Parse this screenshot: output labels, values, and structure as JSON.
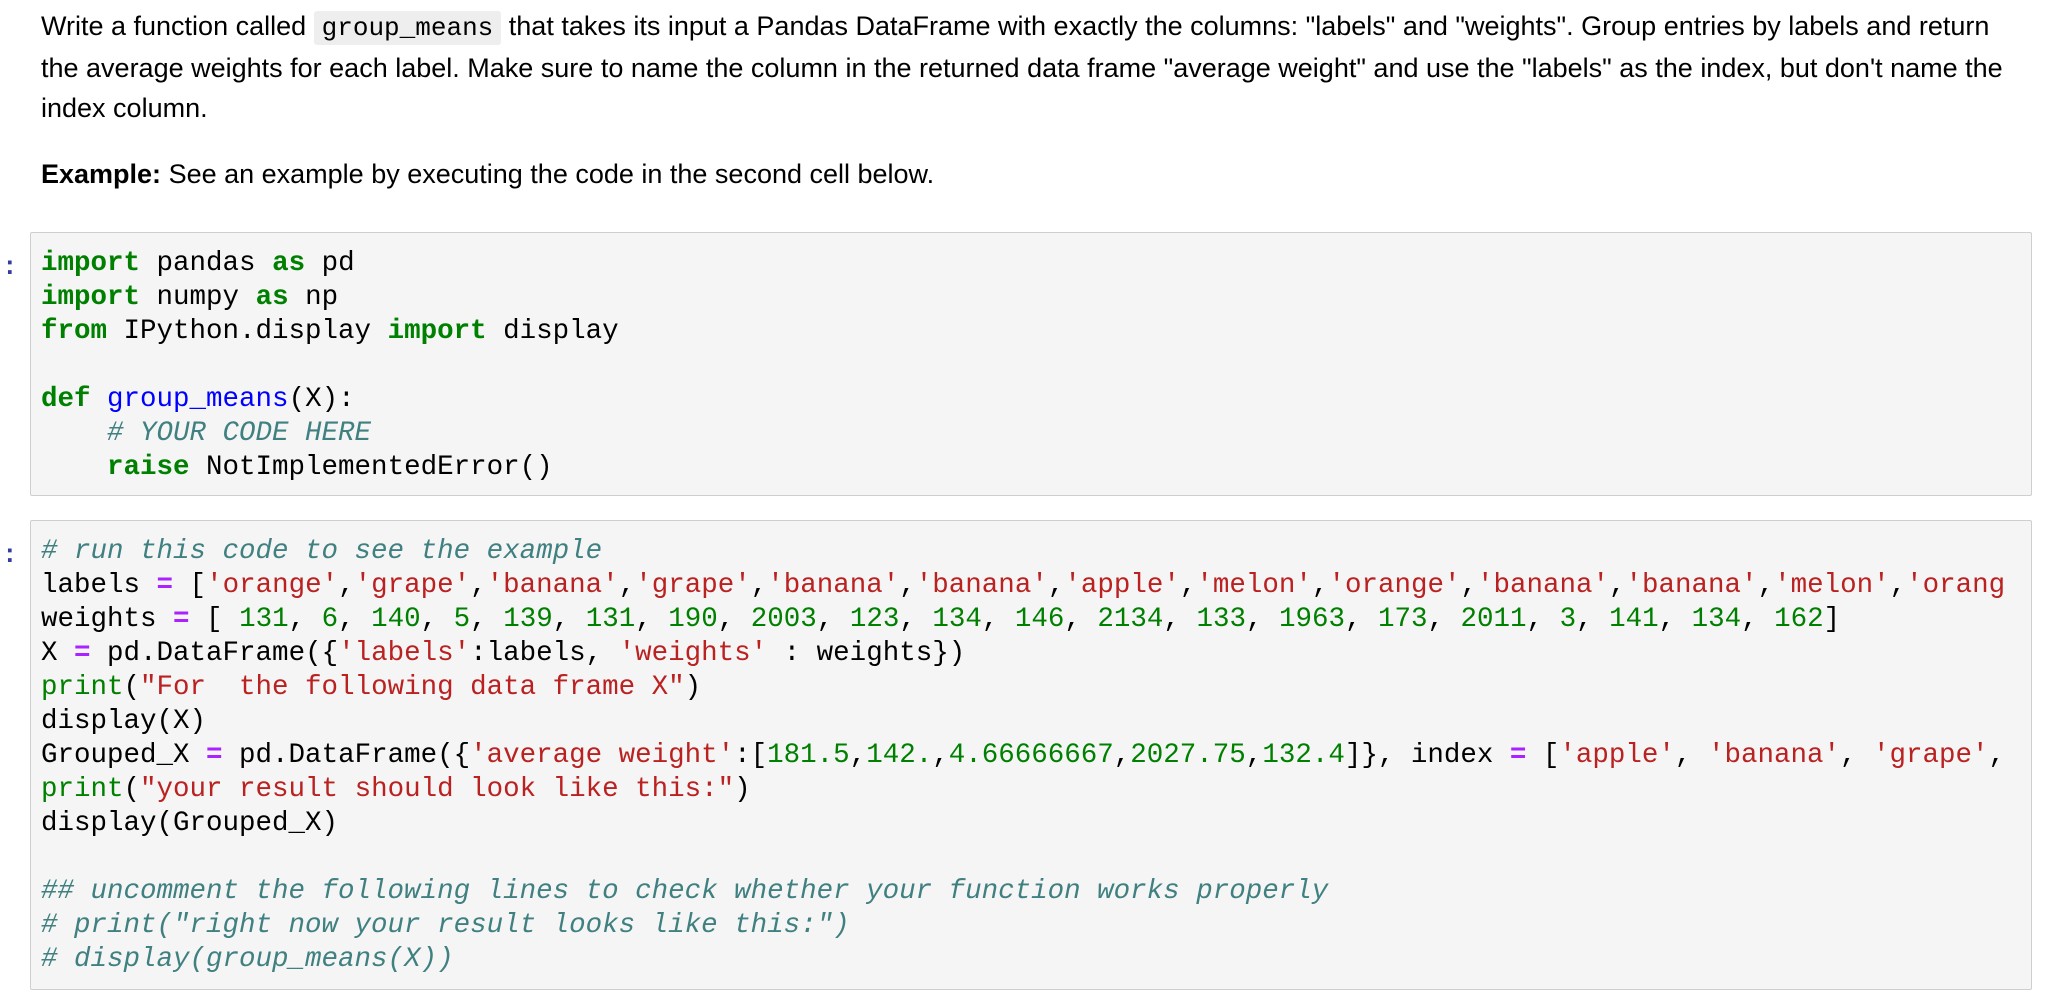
{
  "markdown": {
    "intro_before": "Write a function called ",
    "function_name": "group_means",
    "intro_after": " that takes its input a Pandas DataFrame with exactly the columns: \"labels\" and \"weights\". Group entries by labels and return the average weights for each label. Make sure to name the column in the returned data frame \"average weight\" and use the \"labels\" as the index, but don't name the index column.",
    "example_label": "Example:",
    "example_text": " See an example by executing the code in the second cell below."
  },
  "cell1": {
    "prompt": ":",
    "tokens": [
      [
        "kw",
        "import"
      ],
      [
        "t",
        " pandas "
      ],
      [
        "kw",
        "as"
      ],
      [
        "t",
        " pd\n"
      ],
      [
        "kw",
        "import"
      ],
      [
        "t",
        " numpy "
      ],
      [
        "kw",
        "as"
      ],
      [
        "t",
        " np\n"
      ],
      [
        "kw",
        "from"
      ],
      [
        "t",
        " IPython.display "
      ],
      [
        "kw",
        "import"
      ],
      [
        "t",
        " display\n\n"
      ],
      [
        "kw",
        "def"
      ],
      [
        "t",
        " "
      ],
      [
        "fn",
        "group_means"
      ],
      [
        "t",
        "(X):\n    "
      ],
      [
        "cm",
        "# YOUR CODE HERE"
      ],
      [
        "t",
        "\n    "
      ],
      [
        "kw",
        "raise"
      ],
      [
        "t",
        " NotImplementedError()"
      ]
    ]
  },
  "cell2": {
    "prompt": ":",
    "tokens": [
      [
        "cm",
        "# run this code to see the example"
      ],
      [
        "t",
        "\nlabels "
      ],
      [
        "op",
        "="
      ],
      [
        "t",
        " ["
      ],
      [
        "st",
        "'orange'"
      ],
      [
        "t",
        ","
      ],
      [
        "st",
        "'grape'"
      ],
      [
        "t",
        ","
      ],
      [
        "st",
        "'banana'"
      ],
      [
        "t",
        ","
      ],
      [
        "st",
        "'grape'"
      ],
      [
        "t",
        ","
      ],
      [
        "st",
        "'banana'"
      ],
      [
        "t",
        ","
      ],
      [
        "st",
        "'banana'"
      ],
      [
        "t",
        ","
      ],
      [
        "st",
        "'apple'"
      ],
      [
        "t",
        ","
      ],
      [
        "st",
        "'melon'"
      ],
      [
        "t",
        ","
      ],
      [
        "st",
        "'orange'"
      ],
      [
        "t",
        ","
      ],
      [
        "st",
        "'banana'"
      ],
      [
        "t",
        ","
      ],
      [
        "st",
        "'banana'"
      ],
      [
        "t",
        ","
      ],
      [
        "st",
        "'melon'"
      ],
      [
        "t",
        ","
      ],
      [
        "st",
        "'orang"
      ],
      [
        "t",
        "\nweights "
      ],
      [
        "op",
        "="
      ],
      [
        "t",
        " [ "
      ],
      [
        "nm",
        "131"
      ],
      [
        "t",
        ", "
      ],
      [
        "nm",
        "6"
      ],
      [
        "t",
        ", "
      ],
      [
        "nm",
        "140"
      ],
      [
        "t",
        ", "
      ],
      [
        "nm",
        "5"
      ],
      [
        "t",
        ", "
      ],
      [
        "nm",
        "139"
      ],
      [
        "t",
        ", "
      ],
      [
        "nm",
        "131"
      ],
      [
        "t",
        ", "
      ],
      [
        "nm",
        "190"
      ],
      [
        "t",
        ", "
      ],
      [
        "nm",
        "2003"
      ],
      [
        "t",
        ", "
      ],
      [
        "nm",
        "123"
      ],
      [
        "t",
        ", "
      ],
      [
        "nm",
        "134"
      ],
      [
        "t",
        ", "
      ],
      [
        "nm",
        "146"
      ],
      [
        "t",
        ", "
      ],
      [
        "nm",
        "2134"
      ],
      [
        "t",
        ", "
      ],
      [
        "nm",
        "133"
      ],
      [
        "t",
        ", "
      ],
      [
        "nm",
        "1963"
      ],
      [
        "t",
        ", "
      ],
      [
        "nm",
        "173"
      ],
      [
        "t",
        ", "
      ],
      [
        "nm",
        "2011"
      ],
      [
        "t",
        ", "
      ],
      [
        "nm",
        "3"
      ],
      [
        "t",
        ", "
      ],
      [
        "nm",
        "141"
      ],
      [
        "t",
        ", "
      ],
      [
        "nm",
        "134"
      ],
      [
        "t",
        ", "
      ],
      [
        "nm",
        "162"
      ],
      [
        "t",
        "]"
      ],
      [
        "t",
        "\nX "
      ],
      [
        "op",
        "="
      ],
      [
        "t",
        " pd.DataFrame({"
      ],
      [
        "st",
        "'labels'"
      ],
      [
        "t",
        ":labels, "
      ],
      [
        "st",
        "'weights'"
      ],
      [
        "t",
        " : weights})"
      ],
      [
        "t",
        "\n"
      ],
      [
        "bi",
        "print"
      ],
      [
        "t",
        "("
      ],
      [
        "st",
        "\"For  the following data frame X\""
      ],
      [
        "t",
        ")"
      ],
      [
        "t",
        "\ndisplay(X)"
      ],
      [
        "t",
        "\nGrouped_X "
      ],
      [
        "op",
        "="
      ],
      [
        "t",
        " pd.DataFrame({"
      ],
      [
        "st",
        "'average weight'"
      ],
      [
        "t",
        ":["
      ],
      [
        "nm",
        "181.5"
      ],
      [
        "t",
        ","
      ],
      [
        "nm",
        "142."
      ],
      [
        "t",
        ","
      ],
      [
        "nm",
        "4.66666667"
      ],
      [
        "t",
        ","
      ],
      [
        "nm",
        "2027.75"
      ],
      [
        "t",
        ","
      ],
      [
        "nm",
        "132.4"
      ],
      [
        "t",
        "]}, index "
      ],
      [
        "op",
        "="
      ],
      [
        "t",
        " ["
      ],
      [
        "st",
        "'apple'"
      ],
      [
        "t",
        ", "
      ],
      [
        "st",
        "'banana'"
      ],
      [
        "t",
        ", "
      ],
      [
        "st",
        "'grape'"
      ],
      [
        "t",
        ","
      ],
      [
        "t",
        "\n"
      ],
      [
        "bi",
        "print"
      ],
      [
        "t",
        "("
      ],
      [
        "st",
        "\"your result should look like this:\""
      ],
      [
        "t",
        ")"
      ],
      [
        "t",
        "\ndisplay(Grouped_X)\n\n"
      ],
      [
        "cm",
        "## uncomment the following lines to check whether your function works properly"
      ],
      [
        "t",
        "\n"
      ],
      [
        "cm",
        "# print(\"right now your result looks like this:\")"
      ],
      [
        "t",
        "\n"
      ],
      [
        "cm",
        "# display(group_means(X))"
      ]
    ]
  }
}
